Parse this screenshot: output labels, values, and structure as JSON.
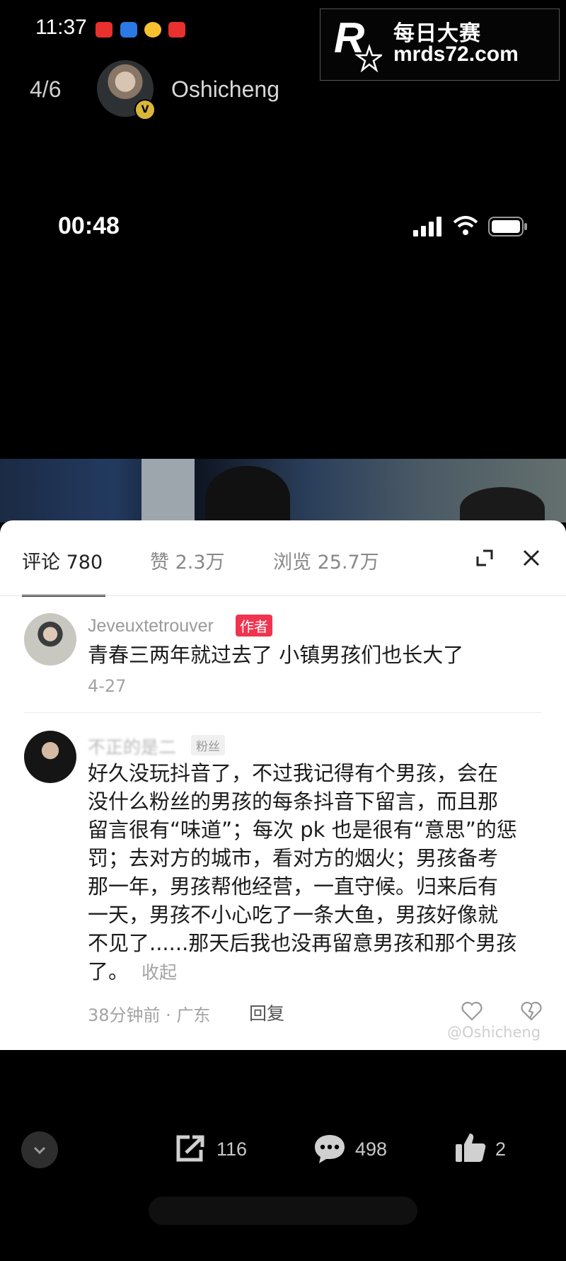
{
  "status_bar": {
    "time": "11:37",
    "app_icons": [
      "red-app",
      "blue-app",
      "weibo",
      "red-app"
    ]
  },
  "watermark": {
    "logo": "R",
    "cn_text": "每日大赛",
    "url": "mrds72.com",
    "logo_sub": "每日大赛"
  },
  "header": {
    "page_indicator": "4/6",
    "username": "Oshicheng",
    "verified": "V"
  },
  "inner_screenshot": {
    "time": "00:48"
  },
  "comments_panel": {
    "tabs": [
      {
        "label": "评论",
        "count": "780"
      },
      {
        "label": "赞",
        "count": "2.3万"
      },
      {
        "label": "浏览",
        "count": "25.7万"
      }
    ],
    "comments": [
      {
        "username": "Jeveuxtetrouver",
        "tag": "作者",
        "text": "青春三两年就过去了 小镇男孩们也长大了",
        "date": "4-27"
      },
      {
        "username": "不正的是二",
        "tag": "粉丝",
        "lines": [
          "好久没玩抖音了，不过我记得有个男孩，会在",
          "没什么粉丝的男孩的每条抖音下留言，而且那",
          "留言很有“味道”；每次 pk 也是很有“意思”的惩",
          "罚；去对方的城市，看对方的烟火；男孩备考",
          "那一年，男孩帮他经营，一直守候。归来后有",
          "一天，男孩不小心吃了一条大鱼，男孩好像就",
          "不见了......那天后我也没再留意男孩和那个男孩",
          "了。"
        ],
        "collapse": "收起",
        "time_location": "38分钟前 · 广东",
        "reply": "回复"
      }
    ],
    "watermark": "@Oshicheng"
  },
  "toolbar": {
    "share_count": "116",
    "comment_count": "498",
    "like_count": "2"
  }
}
